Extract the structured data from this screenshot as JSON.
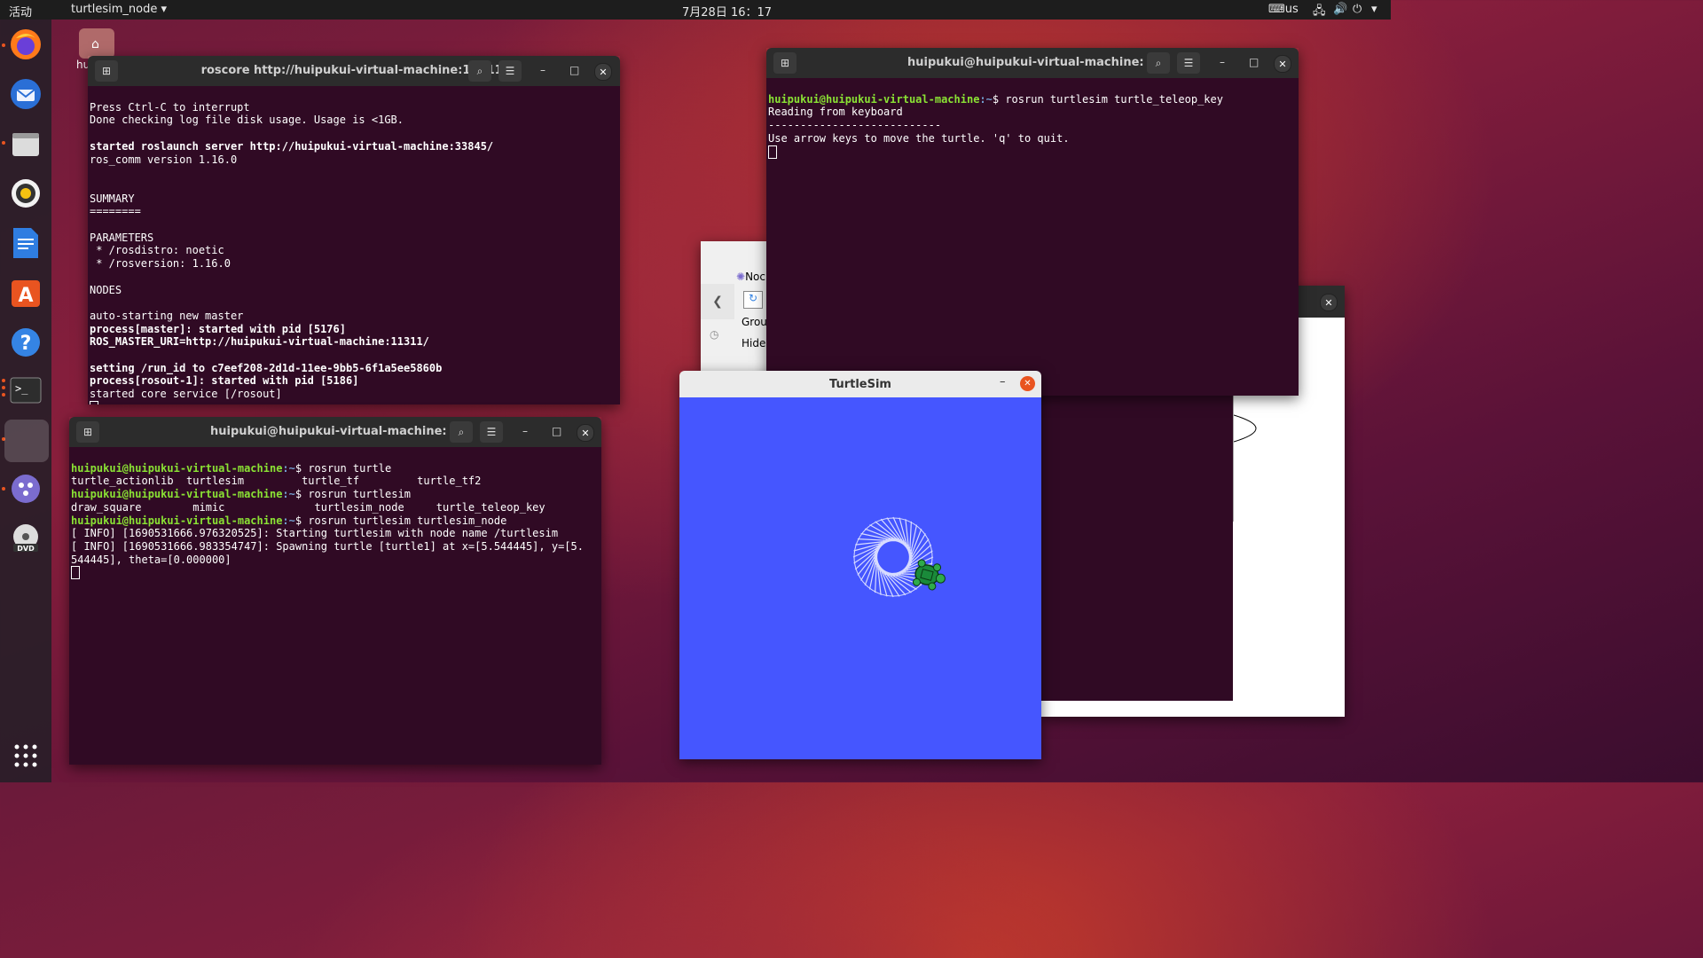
{
  "topbar": {
    "activities": "活动",
    "app_name": "turtlesim_node",
    "clock": "7月28日 16：17",
    "keyboard": "us"
  },
  "desktop": {
    "home_label": "hu"
  },
  "term1": {
    "title": "roscore http://huipukui-virtual-machine:11311/",
    "lines": [
      "Press Ctrl-C to interrupt",
      "Done checking log file disk usage. Usage is <1GB.",
      "",
      "started roslaunch server http://huipukui-virtual-machine:33845/",
      "ros_comm version 1.16.0",
      "",
      "",
      "SUMMARY",
      "========",
      "",
      "PARAMETERS",
      " * /rosdistro: noetic",
      " * /rosversion: 1.16.0",
      "",
      "NODES",
      "",
      "auto-starting new master",
      "process[master]: started with pid [5176]",
      "ROS_MASTER_URI=http://huipukui-virtual-machine:11311/",
      "",
      "setting /run_id to c7eef208-2d1d-11ee-9bb5-6f1a5ee5860b",
      "process[rosout-1]: started with pid [5186]",
      "started core service [/rosout]"
    ]
  },
  "term2": {
    "title": "huipukui@huipukui-virtual-machine: ~",
    "prompt_user": "huipukui@huipukui-virtual-machine",
    "prompt_sep": ":~$ ",
    "cmd1": "rosrun turtle",
    "out1": "turtle_actionlib  turtlesim         turtle_tf         turtle_tf2",
    "cmd2": "rosrun turtlesim",
    "out2": "draw_square        mimic              turtlesim_node     turtle_teleop_key",
    "cmd3": "rosrun turtlesim turtlesim_node",
    "log1": "[ INFO] [1690531666.976320525]: Starting turtlesim with node name /turtlesim",
    "log2": "[ INFO] [1690531666.983354747]: Spawning turtle [turtle1] at x=[5.544445], y=[5.",
    "log3": "544445], theta=[0.000000]"
  },
  "term3": {
    "title": "huipukui@huipukui-virtual-machine: ~",
    "prompt_user": "huipukui@huipukui-virtual-machine",
    "prompt_sep": ":~$ ",
    "cmd": "rosrun turtlesim turtle_teleop_key",
    "out1": "Reading from keyboard",
    "out2": "---------------------------",
    "out3": "Use arrow keys to move the turtle. 'q' to quit."
  },
  "partial": {
    "noc": "Noc",
    "grou": "Grou",
    "hide": "Hide"
  },
  "turtlesim": {
    "title": "TurtleSim",
    "background_color": "#4556ff",
    "pattern_color": "#d8dcff"
  }
}
